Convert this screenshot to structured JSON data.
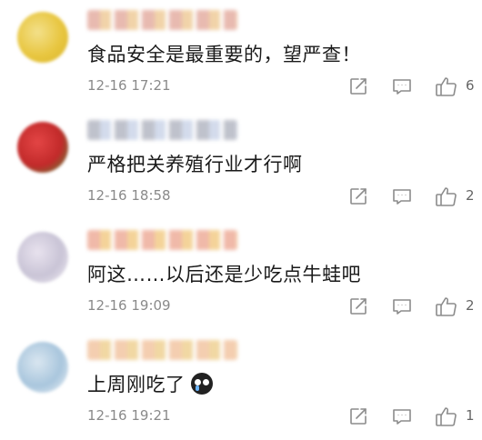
{
  "comments": [
    {
      "text": "食品安全是最重要的，望严查！",
      "time": "12-16 17:21",
      "likes": "6",
      "avatar_colors": [
        "#f3e08a",
        "#e8c640",
        "#d9b52a"
      ],
      "name_colors": [
        "#e6b3a8",
        "#f0cfa0"
      ],
      "emoji": false
    },
    {
      "text": "严格把关养殖行业才行啊",
      "time": "12-16 18:58",
      "likes": "2",
      "avatar_colors": [
        "#e34545",
        "#c22a2a",
        "#4f8f3a"
      ],
      "name_colors": [
        "#b9bcc7",
        "#cfd8ea"
      ],
      "emoji": false
    },
    {
      "text": "阿这……以后还是少吃点牛蛙吧",
      "time": "12-16 19:09",
      "likes": "2",
      "avatar_colors": [
        "#e8e2ee",
        "#c9c4d6",
        "#f2eef5"
      ],
      "name_colors": [
        "#efb2a0",
        "#f3cf8f"
      ],
      "emoji": false
    },
    {
      "text": "上周刚吃了",
      "time": "12-16 19:21",
      "likes": "1",
      "avatar_colors": [
        "#d9e6f0",
        "#a9c6dd",
        "#eef3f7"
      ],
      "name_colors": [
        "#f3c9a8",
        "#f0d49a"
      ],
      "emoji": true,
      "emoji_icon": "sobbing-face-icon"
    }
  ],
  "icons": {
    "share": "share-icon",
    "reply": "comment-icon",
    "like": "thumbs-up-icon"
  }
}
